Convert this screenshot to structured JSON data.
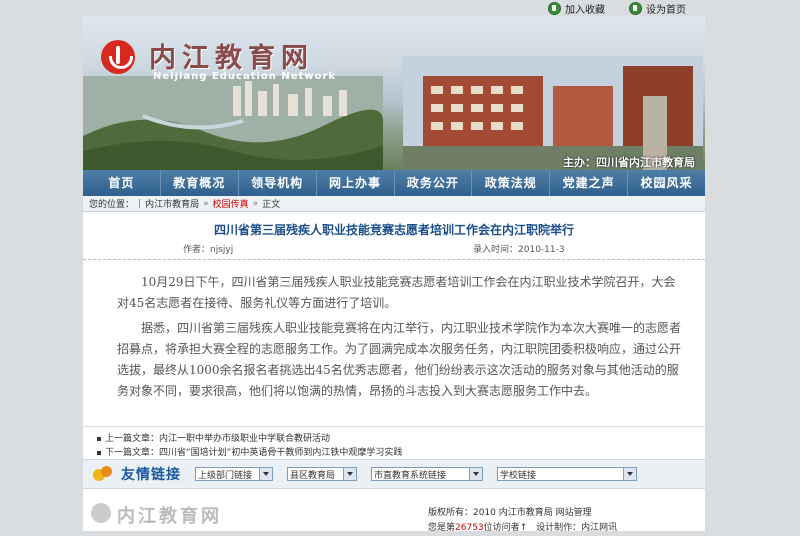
{
  "top_links": {
    "favorite": "加入收藏",
    "homepage": "设为首页"
  },
  "header": {
    "title": "内江教育网",
    "subtitle": "Neijiang Education Network",
    "sponsor": "主办：四川省内江市教育局"
  },
  "nav": [
    "首页",
    "教育概况",
    "领导机构",
    "网上办事",
    "政务公开",
    "政策法规",
    "党建之声",
    "校园风采"
  ],
  "breadcrumb": {
    "prefix": "您的位置：",
    "items": [
      "内江市教育局",
      "校园传真",
      "正文"
    ]
  },
  "article": {
    "title": "四川省第三届残疾人职业技能竞赛志愿者培训工作会在内江职院举行",
    "author_label": "作者：",
    "author": "njsjyj",
    "date_label": "录入时间：",
    "date": "2010-11-3",
    "paragraphs": [
      "10月29日下午，四川省第三届残疾人职业技能竞赛志愿者培训工作会在内江职业技术学院召开，大会对45名志愿者在接待、服务礼仪等方面进行了培训。",
      "据悉，四川省第三届残疾人职业技能竞赛将在内江举行，内江职业技术学院作为本次大赛唯一的志愿者招募点，将承担大赛全程的志愿服务工作。为了圆满完成本次服务任务，内江职院团委积极响应，通过公开选拔，最终从1000余名报名者挑选出45名优秀志愿者，他们纷纷表示这次活动的服务对象与其他活动的服务对象不同，要求很高，他们将以饱满的热情，昂扬的斗志投入到大赛志愿服务工作中去。"
    ]
  },
  "prev_next": {
    "prev_label": "上一篇文章：",
    "prev_title": "内江一职中举办市级职业中学联合教研活动",
    "next_label": "下一篇文章：",
    "next_title": "四川省“国培计划”初中英语骨干教师到内江铁中观摩学习实践"
  },
  "friend_links": {
    "title": "友情链接",
    "selects": [
      "上级部门链接",
      "县区教育局",
      "市直教育系统链接",
      "学校链接"
    ]
  },
  "footer": {
    "logo": "内江教育网",
    "copyright": "版权所有：2010  内江市教育局  网站管理",
    "visitor_prefix": "您是第",
    "visitor_count": "26753",
    "visitor_suffix": "位访问者↑",
    "designer": "设计制作：内江网讯"
  }
}
